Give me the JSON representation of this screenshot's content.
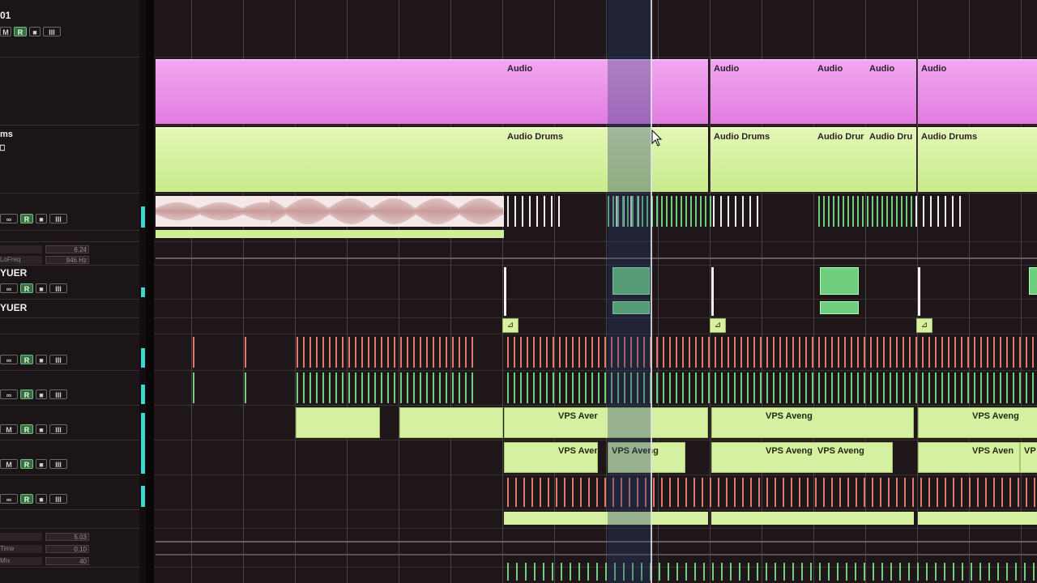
{
  "colors": {
    "background": "#1d1519",
    "pink_clip": "#e17ce2",
    "lime_clip": "#c8eb8b",
    "record_button": "#3a6b45",
    "meter": "#3dd6cf",
    "red_hits": "#e07a6a",
    "green_hits": "#6fcf7f"
  },
  "track_headers": [
    {
      "name": "01",
      "buttons": [
        "M",
        "R",
        "■",
        "III"
      ]
    },
    {
      "name": "ms",
      "extra": "⎕"
    },
    {
      "buttons": [
        "∞",
        "R",
        "■",
        "III"
      ],
      "fields": [
        "6.24",
        "LoFreq",
        "946 Hz"
      ]
    },
    {
      "name": "YUER",
      "buttons": [
        "∞",
        "R",
        "■",
        "III"
      ]
    },
    {
      "name": "YUER"
    },
    {
      "buttons": [
        "∞",
        "R",
        "■",
        "III"
      ]
    },
    {
      "buttons": [
        "∞",
        "R",
        "■",
        "III"
      ]
    },
    {
      "buttons": [
        "M",
        "R",
        "■",
        "III"
      ]
    },
    {
      "buttons": [
        "M",
        "R",
        "■",
        "III"
      ]
    },
    {
      "buttons": [
        "∞",
        "R",
        "■",
        "III"
      ],
      "fields": [
        "5.03",
        "Time",
        "0.10",
        "Mix",
        "40"
      ]
    }
  ],
  "clips": {
    "audio_label": "Audio",
    "audio_drums_label": "Audio Drums",
    "audio_drums_short": "Audio Drur",
    "audio_drums_short2": "Audio Dru",
    "vps_label": "VPS Aveng",
    "vps_short": "VPS Aver",
    "vps_short2": "VPS Aven",
    "vps_tiny": "VP"
  },
  "marker_glyph": "⊿"
}
